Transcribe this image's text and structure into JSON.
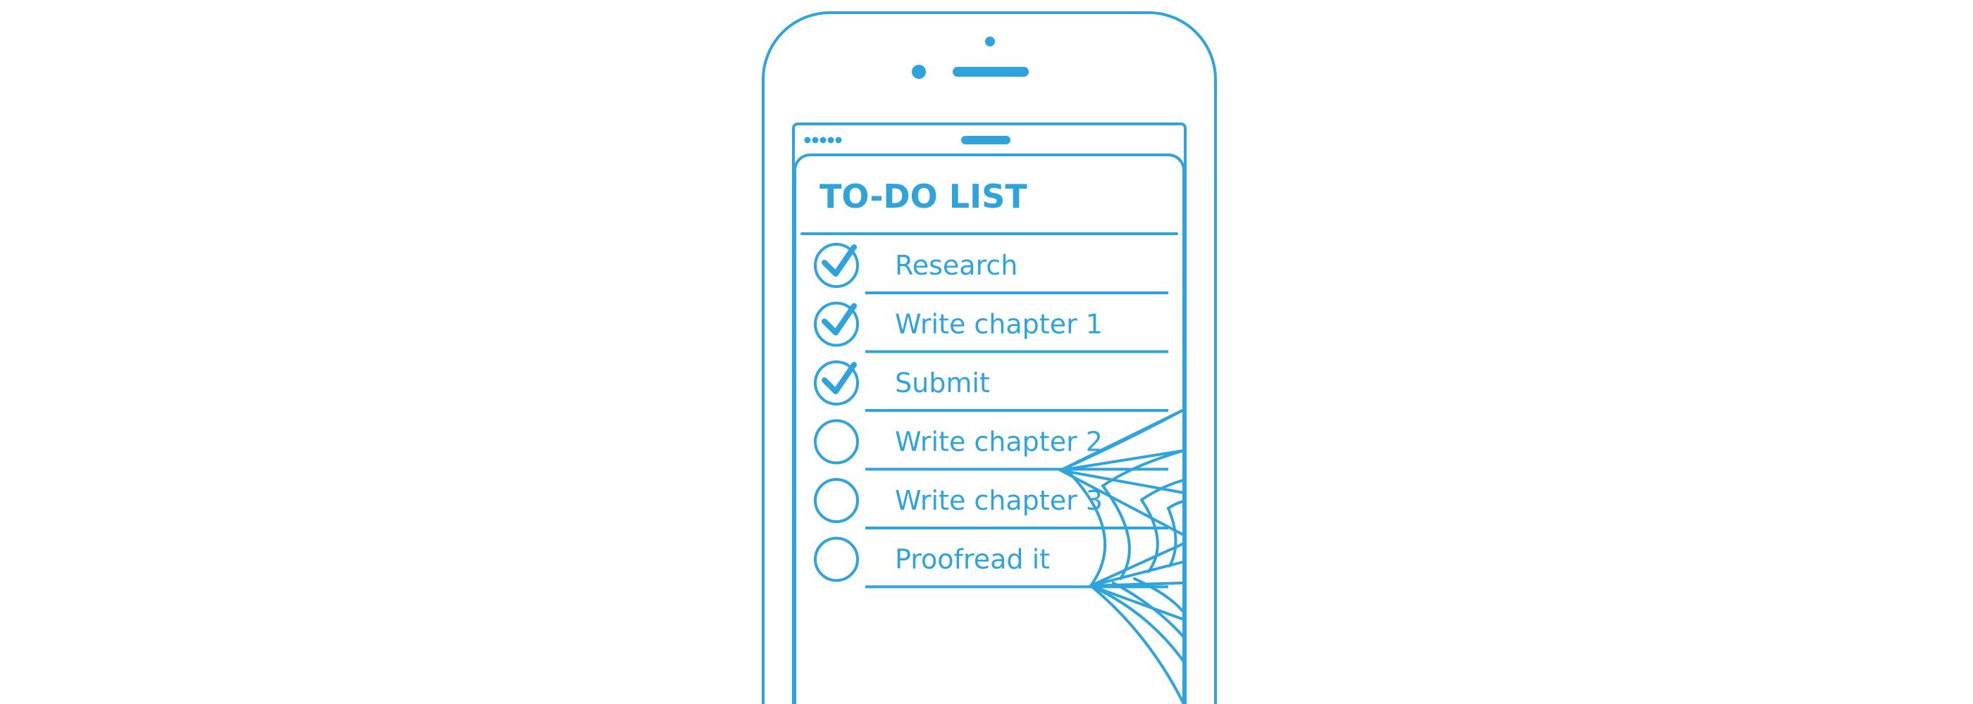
{
  "theme": {
    "accent_color": "#2fa3db",
    "background_color": "#ffffff"
  },
  "device": {
    "type": "smartphone",
    "status_bar": {
      "signal_dots": 5
    }
  },
  "app": {
    "title": "TO-DO LIST",
    "tasks": [
      {
        "label": "Research",
        "done": true
      },
      {
        "label": "Write chapter 1",
        "done": true
      },
      {
        "label": "Submit",
        "done": true
      },
      {
        "label": "Write chapter 2",
        "done": false
      },
      {
        "label": "Write chapter 3",
        "done": false
      },
      {
        "label": "Proofread it",
        "done": false
      }
    ]
  },
  "decorations": {
    "cobweb_icon": "spider-web-icon"
  }
}
